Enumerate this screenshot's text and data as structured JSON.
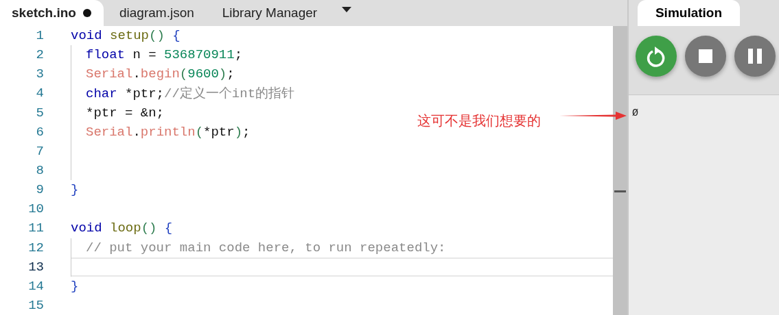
{
  "editor_tabs": [
    {
      "label": "sketch.ino",
      "selected": true,
      "modified": true
    },
    {
      "label": "diagram.json",
      "selected": false,
      "modified": false
    },
    {
      "label": "Library Manager",
      "selected": false,
      "modified": false
    }
  ],
  "code_lines": [
    {
      "number": "1",
      "current": false,
      "guide": false,
      "tokens": [
        {
          "kind": "keyword",
          "text": "void"
        },
        {
          "kind": "func",
          "text": " setup"
        },
        {
          "kind": "paren",
          "text": "()"
        },
        {
          "kind": "brace",
          "text": " {"
        }
      ]
    },
    {
      "number": "2",
      "current": false,
      "guide": true,
      "tokens": [
        {
          "kind": "keyword",
          "text": "float"
        },
        {
          "kind": "plain",
          "text": " n = "
        },
        {
          "kind": "number",
          "text": "536870911"
        },
        {
          "kind": "plain",
          "text": ";"
        }
      ]
    },
    {
      "number": "3",
      "current": false,
      "guide": true,
      "tokens": [
        {
          "kind": "builtin",
          "text": "Serial"
        },
        {
          "kind": "plain",
          "text": "."
        },
        {
          "kind": "builtin",
          "text": "begin"
        },
        {
          "kind": "paren",
          "text": "("
        },
        {
          "kind": "number",
          "text": "9600"
        },
        {
          "kind": "paren",
          "text": ")"
        },
        {
          "kind": "plain",
          "text": ";"
        }
      ]
    },
    {
      "number": "4",
      "current": false,
      "guide": true,
      "tokens": [
        {
          "kind": "keyword",
          "text": "char"
        },
        {
          "kind": "plain",
          "text": " *ptr;"
        },
        {
          "kind": "comment",
          "text": "//定义一个int的指针"
        }
      ]
    },
    {
      "number": "5",
      "current": false,
      "guide": true,
      "tokens": [
        {
          "kind": "plain",
          "text": "*ptr = &n;"
        }
      ]
    },
    {
      "number": "6",
      "current": false,
      "guide": true,
      "tokens": [
        {
          "kind": "builtin",
          "text": "Serial"
        },
        {
          "kind": "plain",
          "text": "."
        },
        {
          "kind": "builtin",
          "text": "println"
        },
        {
          "kind": "paren",
          "text": "("
        },
        {
          "kind": "plain",
          "text": "*ptr"
        },
        {
          "kind": "paren",
          "text": ")"
        },
        {
          "kind": "plain",
          "text": ";"
        }
      ]
    },
    {
      "number": "7",
      "current": false,
      "guide": true
    },
    {
      "number": "8",
      "current": false,
      "guide": true
    },
    {
      "number": "9",
      "current": false,
      "guide": false,
      "tokens": [
        {
          "kind": "brace",
          "text": "}"
        }
      ]
    },
    {
      "number": "10",
      "current": false,
      "guide": false
    },
    {
      "number": "11",
      "current": false,
      "guide": false,
      "tokens": [
        {
          "kind": "keyword",
          "text": "void"
        },
        {
          "kind": "func",
          "text": " loop"
        },
        {
          "kind": "paren",
          "text": "()"
        },
        {
          "kind": "brace",
          "text": " {"
        }
      ]
    },
    {
      "number": "12",
      "current": false,
      "guide": true,
      "tokens": [
        {
          "kind": "comment",
          "text": "// put your main code here, to run repeatedly:"
        }
      ]
    },
    {
      "number": "13",
      "current": true,
      "guide": true
    },
    {
      "number": "14",
      "current": false,
      "guide": false,
      "tokens": [
        {
          "kind": "brace",
          "text": "}"
        }
      ]
    },
    {
      "number": "15",
      "current": false,
      "guide": false
    }
  ],
  "annotation": {
    "text": "这可不是我们想要的"
  },
  "simulation": {
    "tab": {
      "label": "Simulation",
      "selected": true
    },
    "buttons": [
      {
        "kind": "restart"
      },
      {
        "kind": "stop"
      },
      {
        "kind": "pause"
      }
    ],
    "serial_output": [
      "Ø"
    ]
  }
}
